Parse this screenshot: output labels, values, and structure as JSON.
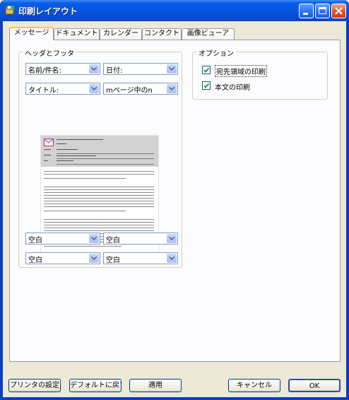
{
  "window": {
    "title": "印刷レイアウト"
  },
  "tabs": [
    "メッセージ",
    "ドキュメント",
    "カレンダー",
    "コンタクト",
    "画像ビューア"
  ],
  "header_footer": {
    "label": "ヘッダとフッタ",
    "top_left": "名前/件名:",
    "top_right": "日付:",
    "mid_left": "タイトル:",
    "mid_right": "mページ中のn",
    "bottom1_left": "空白",
    "bottom1_right": "空白",
    "bottom2_left": "空白",
    "bottom2_right": "空白"
  },
  "options": {
    "label": "オプション",
    "items": [
      {
        "label": "宛先領域の印刷",
        "checked": true
      },
      {
        "label": "本文の印刷",
        "checked": true
      }
    ]
  },
  "buttons": {
    "printer_settings": "プリンタの設定",
    "restore_defaults": "デフォルトに戻す",
    "apply": "適用",
    "cancel": "キャンセル",
    "ok": "OK"
  }
}
